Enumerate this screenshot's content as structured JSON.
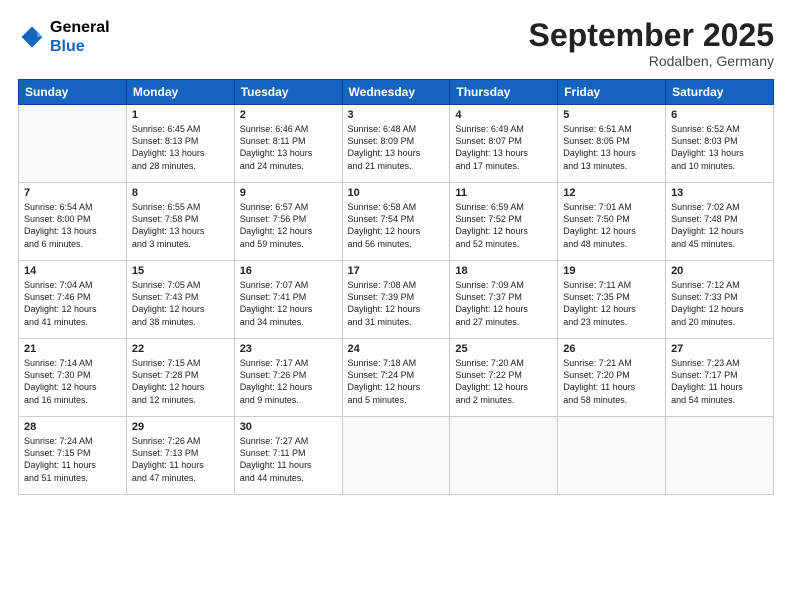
{
  "header": {
    "logo_line1": "General",
    "logo_line2": "Blue",
    "month": "September 2025",
    "location": "Rodalben, Germany"
  },
  "weekdays": [
    "Sunday",
    "Monday",
    "Tuesday",
    "Wednesday",
    "Thursday",
    "Friday",
    "Saturday"
  ],
  "weeks": [
    [
      {
        "day": "",
        "info": ""
      },
      {
        "day": "1",
        "info": "Sunrise: 6:45 AM\nSunset: 8:13 PM\nDaylight: 13 hours\nand 28 minutes."
      },
      {
        "day": "2",
        "info": "Sunrise: 6:46 AM\nSunset: 8:11 PM\nDaylight: 13 hours\nand 24 minutes."
      },
      {
        "day": "3",
        "info": "Sunrise: 6:48 AM\nSunset: 8:09 PM\nDaylight: 13 hours\nand 21 minutes."
      },
      {
        "day": "4",
        "info": "Sunrise: 6:49 AM\nSunset: 8:07 PM\nDaylight: 13 hours\nand 17 minutes."
      },
      {
        "day": "5",
        "info": "Sunrise: 6:51 AM\nSunset: 8:05 PM\nDaylight: 13 hours\nand 13 minutes."
      },
      {
        "day": "6",
        "info": "Sunrise: 6:52 AM\nSunset: 8:03 PM\nDaylight: 13 hours\nand 10 minutes."
      }
    ],
    [
      {
        "day": "7",
        "info": "Sunrise: 6:54 AM\nSunset: 8:00 PM\nDaylight: 13 hours\nand 6 minutes."
      },
      {
        "day": "8",
        "info": "Sunrise: 6:55 AM\nSunset: 7:58 PM\nDaylight: 13 hours\nand 3 minutes."
      },
      {
        "day": "9",
        "info": "Sunrise: 6:57 AM\nSunset: 7:56 PM\nDaylight: 12 hours\nand 59 minutes."
      },
      {
        "day": "10",
        "info": "Sunrise: 6:58 AM\nSunset: 7:54 PM\nDaylight: 12 hours\nand 56 minutes."
      },
      {
        "day": "11",
        "info": "Sunrise: 6:59 AM\nSunset: 7:52 PM\nDaylight: 12 hours\nand 52 minutes."
      },
      {
        "day": "12",
        "info": "Sunrise: 7:01 AM\nSunset: 7:50 PM\nDaylight: 12 hours\nand 48 minutes."
      },
      {
        "day": "13",
        "info": "Sunrise: 7:02 AM\nSunset: 7:48 PM\nDaylight: 12 hours\nand 45 minutes."
      }
    ],
    [
      {
        "day": "14",
        "info": "Sunrise: 7:04 AM\nSunset: 7:46 PM\nDaylight: 12 hours\nand 41 minutes."
      },
      {
        "day": "15",
        "info": "Sunrise: 7:05 AM\nSunset: 7:43 PM\nDaylight: 12 hours\nand 38 minutes."
      },
      {
        "day": "16",
        "info": "Sunrise: 7:07 AM\nSunset: 7:41 PM\nDaylight: 12 hours\nand 34 minutes."
      },
      {
        "day": "17",
        "info": "Sunrise: 7:08 AM\nSunset: 7:39 PM\nDaylight: 12 hours\nand 31 minutes."
      },
      {
        "day": "18",
        "info": "Sunrise: 7:09 AM\nSunset: 7:37 PM\nDaylight: 12 hours\nand 27 minutes."
      },
      {
        "day": "19",
        "info": "Sunrise: 7:11 AM\nSunset: 7:35 PM\nDaylight: 12 hours\nand 23 minutes."
      },
      {
        "day": "20",
        "info": "Sunrise: 7:12 AM\nSunset: 7:33 PM\nDaylight: 12 hours\nand 20 minutes."
      }
    ],
    [
      {
        "day": "21",
        "info": "Sunrise: 7:14 AM\nSunset: 7:30 PM\nDaylight: 12 hours\nand 16 minutes."
      },
      {
        "day": "22",
        "info": "Sunrise: 7:15 AM\nSunset: 7:28 PM\nDaylight: 12 hours\nand 12 minutes."
      },
      {
        "day": "23",
        "info": "Sunrise: 7:17 AM\nSunset: 7:26 PM\nDaylight: 12 hours\nand 9 minutes."
      },
      {
        "day": "24",
        "info": "Sunrise: 7:18 AM\nSunset: 7:24 PM\nDaylight: 12 hours\nand 5 minutes."
      },
      {
        "day": "25",
        "info": "Sunrise: 7:20 AM\nSunset: 7:22 PM\nDaylight: 12 hours\nand 2 minutes."
      },
      {
        "day": "26",
        "info": "Sunrise: 7:21 AM\nSunset: 7:20 PM\nDaylight: 11 hours\nand 58 minutes."
      },
      {
        "day": "27",
        "info": "Sunrise: 7:23 AM\nSunset: 7:17 PM\nDaylight: 11 hours\nand 54 minutes."
      }
    ],
    [
      {
        "day": "28",
        "info": "Sunrise: 7:24 AM\nSunset: 7:15 PM\nDaylight: 11 hours\nand 51 minutes."
      },
      {
        "day": "29",
        "info": "Sunrise: 7:26 AM\nSunset: 7:13 PM\nDaylight: 11 hours\nand 47 minutes."
      },
      {
        "day": "30",
        "info": "Sunrise: 7:27 AM\nSunset: 7:11 PM\nDaylight: 11 hours\nand 44 minutes."
      },
      {
        "day": "",
        "info": ""
      },
      {
        "day": "",
        "info": ""
      },
      {
        "day": "",
        "info": ""
      },
      {
        "day": "",
        "info": ""
      }
    ]
  ]
}
